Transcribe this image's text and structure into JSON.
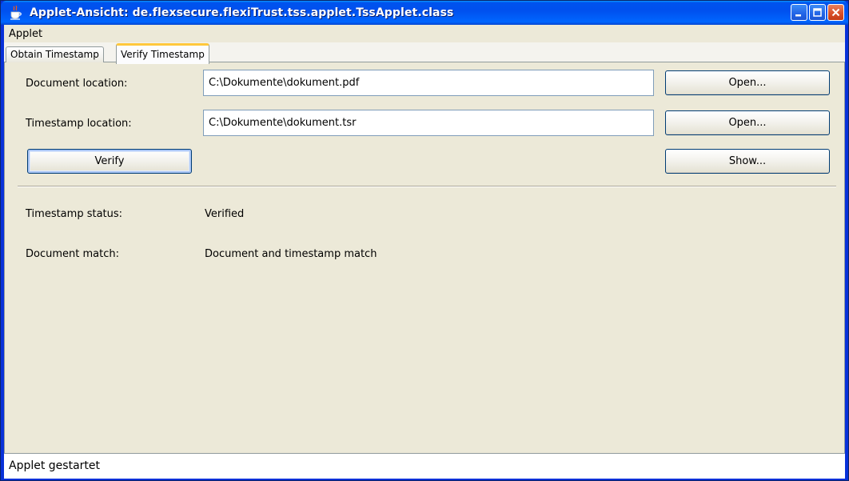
{
  "window": {
    "title": "Applet-Ansicht: de.flexsecure.flexiTrust.tss.applet.TssApplet.class",
    "icon": "java-cup-icon",
    "controls": [
      "minimize-icon",
      "maximize-icon",
      "close-icon"
    ]
  },
  "menubar": {
    "items": [
      {
        "label": "Applet"
      }
    ]
  },
  "tabs": [
    {
      "label": "Obtain Timestamp",
      "active": false
    },
    {
      "label": "Verify Timestamp",
      "active": true
    }
  ],
  "verify": {
    "document_label": "Document location:",
    "document_value": "C:\\Dokumente\\dokument.pdf",
    "document_open": "Open...",
    "timestamp_label": "Timestamp location:",
    "timestamp_value": "C:\\Dokumente\\dokument.tsr",
    "timestamp_open": "Open...",
    "verify_button": "Verify",
    "show_button": "Show...",
    "status_label": "Timestamp status:",
    "status_value": "Verified",
    "match_label": "Document match:",
    "match_value": "Document and timestamp match"
  },
  "statusbar": {
    "text": "Applet gestartet"
  },
  "colors": {
    "titlebar": "#0053ee",
    "panel": "#ece9d8",
    "active_tab_highlight": "#ffc83c",
    "close_button": "#d9512a"
  }
}
